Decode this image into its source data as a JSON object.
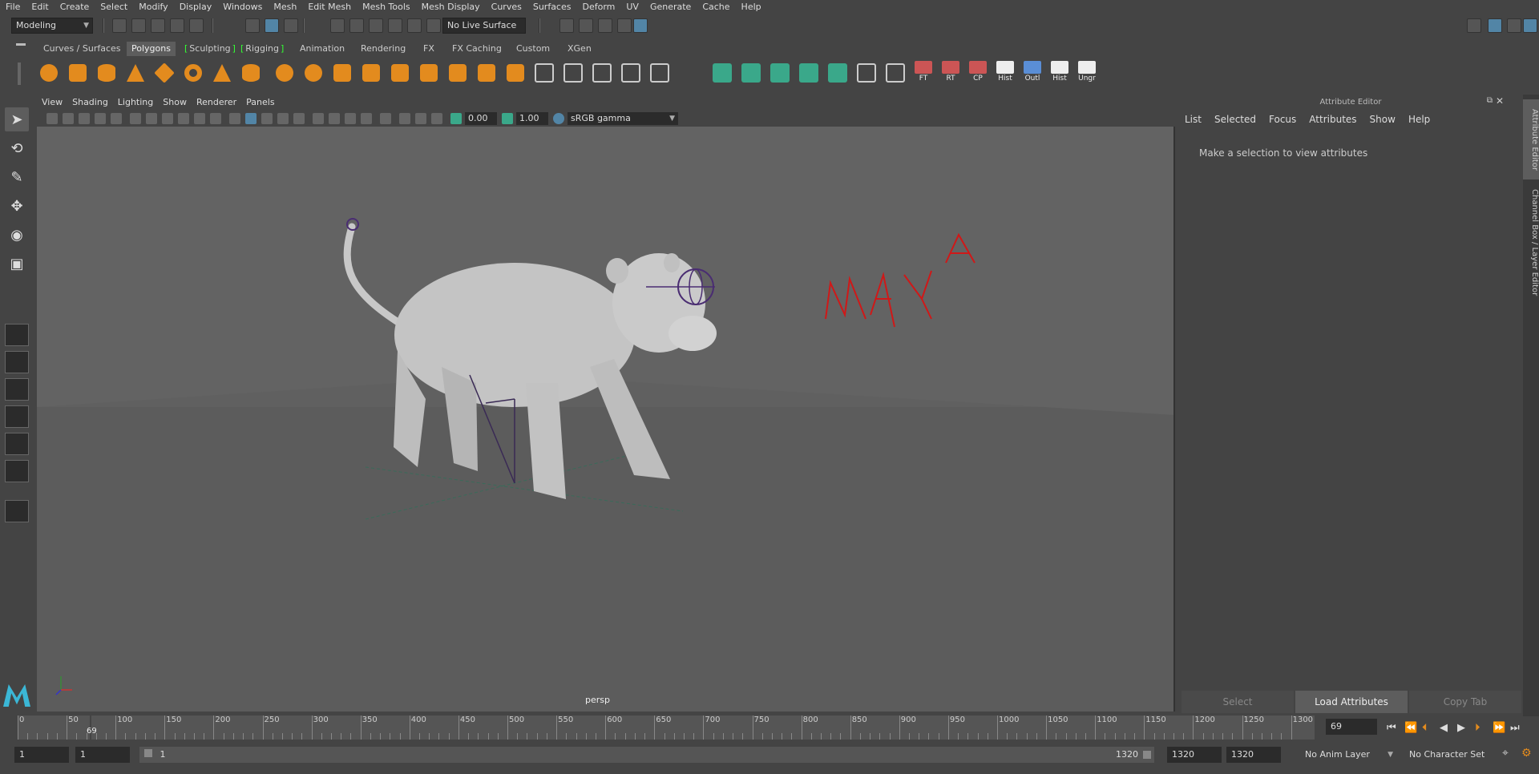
{
  "menubar": {
    "items": [
      "File",
      "Edit",
      "Create",
      "Select",
      "Modify",
      "Display",
      "Windows",
      "Mesh",
      "Edit Mesh",
      "Mesh Tools",
      "Mesh Display",
      "Curves",
      "Surfaces",
      "Deform",
      "UV",
      "Generate",
      "Cache",
      "Help"
    ]
  },
  "statusline": {
    "mode": "Modeling",
    "live_surface": "No Live Surface"
  },
  "shelf": {
    "tabs": [
      "Curves / Surfaces",
      "Polygons",
      "Sculpting",
      "Rigging",
      "Animation",
      "Rendering",
      "FX",
      "FX Caching",
      "Custom",
      "XGen"
    ],
    "active_tab": "Polygons",
    "text_icons": [
      "FT",
      "RT",
      "CP",
      "Hist",
      "Outl",
      "Hist",
      "Ungr"
    ]
  },
  "viewport": {
    "menu": [
      "View",
      "Shading",
      "Lighting",
      "Show",
      "Renderer",
      "Panels"
    ],
    "exposure": "0.00",
    "gamma": "1.00",
    "colorspace": "sRGB gamma",
    "camera": "persp",
    "scene_text": "MAYA"
  },
  "attribute_editor": {
    "title": "Attribute Editor",
    "menu": [
      "List",
      "Selected",
      "Focus",
      "Attributes",
      "Show",
      "Help"
    ],
    "message": "Make a selection to view attributes",
    "buttons": [
      "Select",
      "Load Attributes",
      "Copy Tab"
    ],
    "side_tabs": [
      "Attribute Editor",
      "Channel Box / Layer Editor"
    ]
  },
  "timeslider": {
    "ticks": [
      "0",
      "50",
      "100",
      "150",
      "200",
      "250",
      "300",
      "350",
      "400",
      "450",
      "500",
      "550",
      "600",
      "650",
      "700",
      "750",
      "800",
      "850",
      "900",
      "950",
      "1000",
      "1050",
      "1100",
      "1150",
      "1200",
      "1250",
      "1300"
    ],
    "current_frame": "69",
    "current_frame_field": "69"
  },
  "range": {
    "start": "1",
    "playback_start": "1",
    "slider_start": "1",
    "slider_end": "1320",
    "playback_end": "1320",
    "end": "1320",
    "anim_layer": "No Anim Layer",
    "char_set": "No Character Set"
  },
  "colors": {
    "accent": "#5285a6",
    "shelf_orange": "#e38b1e",
    "shelf_green": "#3aa88a",
    "scene_text": "#d01818"
  }
}
